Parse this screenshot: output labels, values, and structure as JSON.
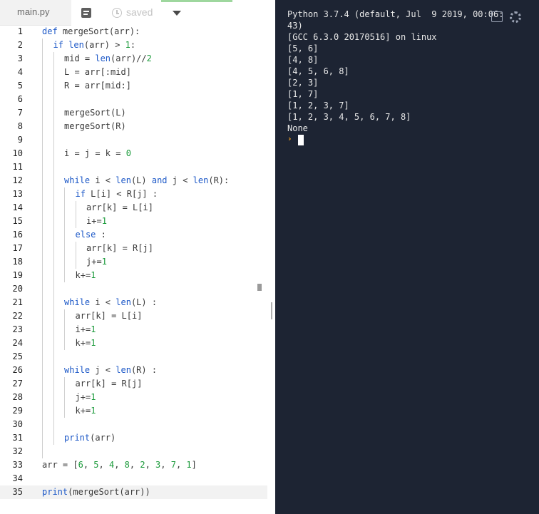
{
  "tabs": {
    "file_name": "main.py",
    "saved_status": "saved"
  },
  "editor": {
    "active_line": 35,
    "lines": [
      {
        "n": "1",
        "indent": 0,
        "guides": 0,
        "parts": [
          [
            "kw",
            "def"
          ],
          [
            "t",
            " mergeSort(arr):"
          ]
        ]
      },
      {
        "n": "2",
        "indent": 1,
        "guides": 1,
        "parts": [
          [
            "kw",
            "if"
          ],
          [
            "t",
            " "
          ],
          [
            "kw",
            "len"
          ],
          [
            "t",
            "(arr) > "
          ],
          [
            "num",
            "1"
          ],
          [
            "t",
            ":"
          ]
        ]
      },
      {
        "n": "3",
        "indent": 2,
        "guides": 2,
        "parts": [
          [
            "t",
            "mid = "
          ],
          [
            "kw",
            "len"
          ],
          [
            "t",
            "(arr)//"
          ],
          [
            "num",
            "2"
          ]
        ]
      },
      {
        "n": "4",
        "indent": 2,
        "guides": 2,
        "parts": [
          [
            "t",
            "L = arr[:mid]"
          ]
        ]
      },
      {
        "n": "5",
        "indent": 2,
        "guides": 2,
        "parts": [
          [
            "t",
            "R = arr[mid:]"
          ]
        ]
      },
      {
        "n": "6",
        "indent": 2,
        "guides": 2,
        "parts": []
      },
      {
        "n": "7",
        "indent": 2,
        "guides": 2,
        "parts": [
          [
            "t",
            "mergeSort(L)"
          ]
        ]
      },
      {
        "n": "8",
        "indent": 2,
        "guides": 2,
        "parts": [
          [
            "t",
            "mergeSort(R)"
          ]
        ]
      },
      {
        "n": "9",
        "indent": 2,
        "guides": 2,
        "parts": []
      },
      {
        "n": "10",
        "indent": 2,
        "guides": 2,
        "parts": [
          [
            "t",
            "i = j = k = "
          ],
          [
            "num",
            "0"
          ]
        ]
      },
      {
        "n": "11",
        "indent": 2,
        "guides": 2,
        "parts": []
      },
      {
        "n": "12",
        "indent": 2,
        "guides": 2,
        "parts": [
          [
            "kw",
            "while"
          ],
          [
            "t",
            " i < "
          ],
          [
            "kw",
            "len"
          ],
          [
            "t",
            "(L) "
          ],
          [
            "kw",
            "and"
          ],
          [
            "t",
            " j < "
          ],
          [
            "kw",
            "len"
          ],
          [
            "t",
            "(R):"
          ]
        ]
      },
      {
        "n": "13",
        "indent": 3,
        "guides": 3,
        "parts": [
          [
            "kw",
            "if"
          ],
          [
            "t",
            " L[i] < R[j] :"
          ]
        ]
      },
      {
        "n": "14",
        "indent": 4,
        "guides": 4,
        "parts": [
          [
            "t",
            "arr[k] = L[i]"
          ]
        ]
      },
      {
        "n": "15",
        "indent": 4,
        "guides": 4,
        "parts": [
          [
            "t",
            "i+="
          ],
          [
            "num",
            "1"
          ]
        ]
      },
      {
        "n": "16",
        "indent": 3,
        "guides": 3,
        "parts": [
          [
            "kw",
            "else"
          ],
          [
            "t",
            " :"
          ]
        ]
      },
      {
        "n": "17",
        "indent": 4,
        "guides": 4,
        "parts": [
          [
            "t",
            "arr[k] = R[j]"
          ]
        ]
      },
      {
        "n": "18",
        "indent": 4,
        "guides": 4,
        "parts": [
          [
            "t",
            "j+="
          ],
          [
            "num",
            "1"
          ]
        ]
      },
      {
        "n": "19",
        "indent": 3,
        "guides": 3,
        "parts": [
          [
            "t",
            "k+="
          ],
          [
            "num",
            "1"
          ]
        ]
      },
      {
        "n": "20",
        "indent": 2,
        "guides": 2,
        "parts": []
      },
      {
        "n": "21",
        "indent": 2,
        "guides": 2,
        "parts": [
          [
            "kw",
            "while"
          ],
          [
            "t",
            " i < "
          ],
          [
            "kw",
            "len"
          ],
          [
            "t",
            "(L) :"
          ]
        ]
      },
      {
        "n": "22",
        "indent": 3,
        "guides": 3,
        "parts": [
          [
            "t",
            "arr[k] = L[i]"
          ]
        ]
      },
      {
        "n": "23",
        "indent": 3,
        "guides": 3,
        "parts": [
          [
            "t",
            "i+="
          ],
          [
            "num",
            "1"
          ]
        ]
      },
      {
        "n": "24",
        "indent": 3,
        "guides": 3,
        "parts": [
          [
            "t",
            "k+="
          ],
          [
            "num",
            "1"
          ]
        ]
      },
      {
        "n": "25",
        "indent": 2,
        "guides": 2,
        "parts": []
      },
      {
        "n": "26",
        "indent": 2,
        "guides": 2,
        "parts": [
          [
            "kw",
            "while"
          ],
          [
            "t",
            " j < "
          ],
          [
            "kw",
            "len"
          ],
          [
            "t",
            "(R) :"
          ]
        ]
      },
      {
        "n": "27",
        "indent": 3,
        "guides": 3,
        "parts": [
          [
            "t",
            "arr[k] = R[j]"
          ]
        ]
      },
      {
        "n": "28",
        "indent": 3,
        "guides": 3,
        "parts": [
          [
            "t",
            "j+="
          ],
          [
            "num",
            "1"
          ]
        ]
      },
      {
        "n": "29",
        "indent": 3,
        "guides": 3,
        "parts": [
          [
            "t",
            "k+="
          ],
          [
            "num",
            "1"
          ]
        ]
      },
      {
        "n": "30",
        "indent": 2,
        "guides": 2,
        "parts": []
      },
      {
        "n": "31",
        "indent": 2,
        "guides": 2,
        "parts": [
          [
            "kw",
            "print"
          ],
          [
            "t",
            "(arr)"
          ]
        ]
      },
      {
        "n": "32",
        "indent": 1,
        "guides": 1,
        "parts": []
      },
      {
        "n": "33",
        "indent": 0,
        "guides": 0,
        "parts": [
          [
            "t",
            "arr = ["
          ],
          [
            "num",
            "6"
          ],
          [
            "t",
            ", "
          ],
          [
            "num",
            "5"
          ],
          [
            "t",
            ", "
          ],
          [
            "num",
            "4"
          ],
          [
            "t",
            ", "
          ],
          [
            "num",
            "8"
          ],
          [
            "t",
            ", "
          ],
          [
            "num",
            "2"
          ],
          [
            "t",
            ", "
          ],
          [
            "num",
            "3"
          ],
          [
            "t",
            ", "
          ],
          [
            "num",
            "7"
          ],
          [
            "t",
            ", "
          ],
          [
            "num",
            "1"
          ],
          [
            "t",
            "]"
          ]
        ]
      },
      {
        "n": "34",
        "indent": 0,
        "guides": 0,
        "parts": []
      },
      {
        "n": "35",
        "indent": 0,
        "guides": 0,
        "parts": [
          [
            "kw",
            "print"
          ],
          [
            "t",
            "(mergeSort(arr))"
          ]
        ]
      }
    ]
  },
  "console": {
    "lines": [
      "Python 3.7.4 (default, Jul  9 2019, 00:06:",
      "43)",
      "[GCC 6.3.0 20170516] on linux",
      "[5, 6]",
      "[4, 8]",
      "[4, 5, 6, 8]",
      "[2, 3]",
      "[1, 7]",
      "[1, 2, 3, 7]",
      "[1, 2, 3, 4, 5, 6, 7, 8]",
      "None"
    ],
    "prompt_symbol": "›"
  },
  "colors": {
    "keyword": "#1b57c7",
    "number": "#1a9a3a",
    "console_bg": "#1d2433",
    "prompt": "#f7a21b"
  },
  "icons": {
    "notes": "notes-icon",
    "history": "history-icon",
    "dropdown": "chevron-down-icon",
    "copy": "copy-icon",
    "settings": "settings-icon"
  }
}
